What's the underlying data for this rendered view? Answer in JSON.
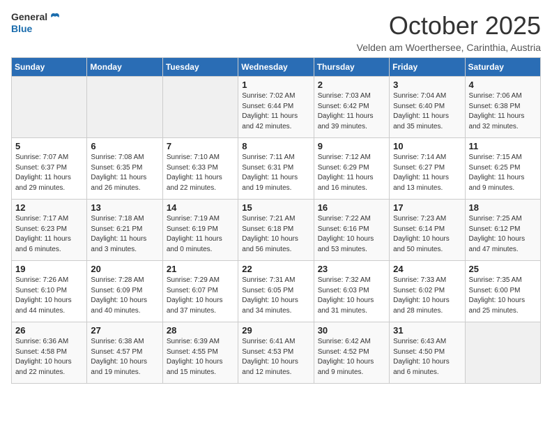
{
  "logo": {
    "general": "General",
    "blue": "Blue"
  },
  "title": "October 2025",
  "subtitle": "Velden am Woerthersee, Carinthia, Austria",
  "days_of_week": [
    "Sunday",
    "Monday",
    "Tuesday",
    "Wednesday",
    "Thursday",
    "Friday",
    "Saturday"
  ],
  "weeks": [
    [
      {
        "day": "",
        "sunrise": "",
        "sunset": "",
        "daylight": ""
      },
      {
        "day": "",
        "sunrise": "",
        "sunset": "",
        "daylight": ""
      },
      {
        "day": "",
        "sunrise": "",
        "sunset": "",
        "daylight": ""
      },
      {
        "day": "1",
        "sunrise": "Sunrise: 7:02 AM",
        "sunset": "Sunset: 6:44 PM",
        "daylight": "Daylight: 11 hours and 42 minutes."
      },
      {
        "day": "2",
        "sunrise": "Sunrise: 7:03 AM",
        "sunset": "Sunset: 6:42 PM",
        "daylight": "Daylight: 11 hours and 39 minutes."
      },
      {
        "day": "3",
        "sunrise": "Sunrise: 7:04 AM",
        "sunset": "Sunset: 6:40 PM",
        "daylight": "Daylight: 11 hours and 35 minutes."
      },
      {
        "day": "4",
        "sunrise": "Sunrise: 7:06 AM",
        "sunset": "Sunset: 6:38 PM",
        "daylight": "Daylight: 11 hours and 32 minutes."
      }
    ],
    [
      {
        "day": "5",
        "sunrise": "Sunrise: 7:07 AM",
        "sunset": "Sunset: 6:37 PM",
        "daylight": "Daylight: 11 hours and 29 minutes."
      },
      {
        "day": "6",
        "sunrise": "Sunrise: 7:08 AM",
        "sunset": "Sunset: 6:35 PM",
        "daylight": "Daylight: 11 hours and 26 minutes."
      },
      {
        "day": "7",
        "sunrise": "Sunrise: 7:10 AM",
        "sunset": "Sunset: 6:33 PM",
        "daylight": "Daylight: 11 hours and 22 minutes."
      },
      {
        "day": "8",
        "sunrise": "Sunrise: 7:11 AM",
        "sunset": "Sunset: 6:31 PM",
        "daylight": "Daylight: 11 hours and 19 minutes."
      },
      {
        "day": "9",
        "sunrise": "Sunrise: 7:12 AM",
        "sunset": "Sunset: 6:29 PM",
        "daylight": "Daylight: 11 hours and 16 minutes."
      },
      {
        "day": "10",
        "sunrise": "Sunrise: 7:14 AM",
        "sunset": "Sunset: 6:27 PM",
        "daylight": "Daylight: 11 hours and 13 minutes."
      },
      {
        "day": "11",
        "sunrise": "Sunrise: 7:15 AM",
        "sunset": "Sunset: 6:25 PM",
        "daylight": "Daylight: 11 hours and 9 minutes."
      }
    ],
    [
      {
        "day": "12",
        "sunrise": "Sunrise: 7:17 AM",
        "sunset": "Sunset: 6:23 PM",
        "daylight": "Daylight: 11 hours and 6 minutes."
      },
      {
        "day": "13",
        "sunrise": "Sunrise: 7:18 AM",
        "sunset": "Sunset: 6:21 PM",
        "daylight": "Daylight: 11 hours and 3 minutes."
      },
      {
        "day": "14",
        "sunrise": "Sunrise: 7:19 AM",
        "sunset": "Sunset: 6:19 PM",
        "daylight": "Daylight: 11 hours and 0 minutes."
      },
      {
        "day": "15",
        "sunrise": "Sunrise: 7:21 AM",
        "sunset": "Sunset: 6:18 PM",
        "daylight": "Daylight: 10 hours and 56 minutes."
      },
      {
        "day": "16",
        "sunrise": "Sunrise: 7:22 AM",
        "sunset": "Sunset: 6:16 PM",
        "daylight": "Daylight: 10 hours and 53 minutes."
      },
      {
        "day": "17",
        "sunrise": "Sunrise: 7:23 AM",
        "sunset": "Sunset: 6:14 PM",
        "daylight": "Daylight: 10 hours and 50 minutes."
      },
      {
        "day": "18",
        "sunrise": "Sunrise: 7:25 AM",
        "sunset": "Sunset: 6:12 PM",
        "daylight": "Daylight: 10 hours and 47 minutes."
      }
    ],
    [
      {
        "day": "19",
        "sunrise": "Sunrise: 7:26 AM",
        "sunset": "Sunset: 6:10 PM",
        "daylight": "Daylight: 10 hours and 44 minutes."
      },
      {
        "day": "20",
        "sunrise": "Sunrise: 7:28 AM",
        "sunset": "Sunset: 6:09 PM",
        "daylight": "Daylight: 10 hours and 40 minutes."
      },
      {
        "day": "21",
        "sunrise": "Sunrise: 7:29 AM",
        "sunset": "Sunset: 6:07 PM",
        "daylight": "Daylight: 10 hours and 37 minutes."
      },
      {
        "day": "22",
        "sunrise": "Sunrise: 7:31 AM",
        "sunset": "Sunset: 6:05 PM",
        "daylight": "Daylight: 10 hours and 34 minutes."
      },
      {
        "day": "23",
        "sunrise": "Sunrise: 7:32 AM",
        "sunset": "Sunset: 6:03 PM",
        "daylight": "Daylight: 10 hours and 31 minutes."
      },
      {
        "day": "24",
        "sunrise": "Sunrise: 7:33 AM",
        "sunset": "Sunset: 6:02 PM",
        "daylight": "Daylight: 10 hours and 28 minutes."
      },
      {
        "day": "25",
        "sunrise": "Sunrise: 7:35 AM",
        "sunset": "Sunset: 6:00 PM",
        "daylight": "Daylight: 10 hours and 25 minutes."
      }
    ],
    [
      {
        "day": "26",
        "sunrise": "Sunrise: 6:36 AM",
        "sunset": "Sunset: 4:58 PM",
        "daylight": "Daylight: 10 hours and 22 minutes."
      },
      {
        "day": "27",
        "sunrise": "Sunrise: 6:38 AM",
        "sunset": "Sunset: 4:57 PM",
        "daylight": "Daylight: 10 hours and 19 minutes."
      },
      {
        "day": "28",
        "sunrise": "Sunrise: 6:39 AM",
        "sunset": "Sunset: 4:55 PM",
        "daylight": "Daylight: 10 hours and 15 minutes."
      },
      {
        "day": "29",
        "sunrise": "Sunrise: 6:41 AM",
        "sunset": "Sunset: 4:53 PM",
        "daylight": "Daylight: 10 hours and 12 minutes."
      },
      {
        "day": "30",
        "sunrise": "Sunrise: 6:42 AM",
        "sunset": "Sunset: 4:52 PM",
        "daylight": "Daylight: 10 hours and 9 minutes."
      },
      {
        "day": "31",
        "sunrise": "Sunrise: 6:43 AM",
        "sunset": "Sunset: 4:50 PM",
        "daylight": "Daylight: 10 hours and 6 minutes."
      },
      {
        "day": "",
        "sunrise": "",
        "sunset": "",
        "daylight": ""
      }
    ]
  ]
}
